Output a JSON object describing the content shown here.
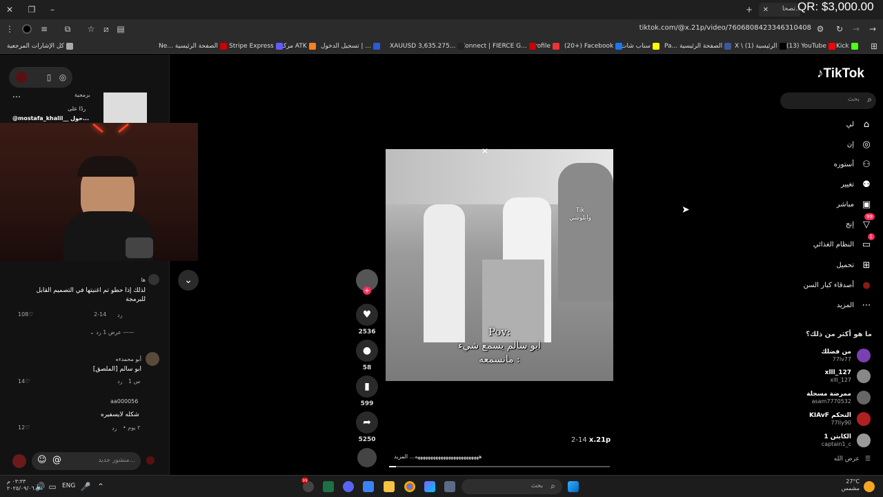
{
  "window": {
    "overlay_title": "QR: $3,000.00",
    "tab_title": "تصحا..."
  },
  "address": {
    "url": "tiktok.com/@x.21p/video/7606808423346310408"
  },
  "bookmarks": [
    {
      "label": "Kick",
      "color": "#53fc18"
    },
    {
      "label": "(13) YouTube",
      "color": "#ff0000"
    },
    {
      "label": "X \\ (1) الرئيسية",
      "color": "#000000"
    },
    {
      "label": "Pa... الصفحة الرئيسية",
      "color": "#3b5998"
    },
    {
      "label": "سناب شات",
      "color": "#fffc00"
    },
    {
      "label": "(20+) Facebook",
      "color": "#1877f2"
    },
    {
      "label": "Profile",
      "color": "#e33"
    },
    {
      "label": "Connect | FIERCE G...",
      "color": "#c00"
    },
    {
      "label": "XAUUSD 3,635.275...",
      "color": "#222"
    },
    {
      "label": "تسجيل الدخول | ...",
      "color": "#2a5bd7"
    },
    {
      "label": "مركز ATK",
      "color": "#f58220"
    },
    {
      "label": "Stripe Express",
      "color": "#635bff"
    },
    {
      "label": "Ne... الصفحة الرئيسية",
      "color": "#c00"
    },
    {
      "label": "كل الإشارات المرجعية",
      "color": "#aaa"
    }
  ],
  "tiktok": {
    "logo": "TikTok",
    "search_placeholder": "بحث",
    "nav": [
      {
        "label": "لي",
        "icon": "home-icon",
        "glyph": "⌂"
      },
      {
        "label": "إن",
        "icon": "compass-icon",
        "glyph": "◎"
      },
      {
        "label": "أستوره",
        "icon": "user-plus-icon",
        "glyph": "⚇"
      },
      {
        "label": "تغيير",
        "icon": "users-icon",
        "glyph": "⚉"
      },
      {
        "label": "مباشر",
        "icon": "live-icon",
        "glyph": "▣"
      },
      {
        "label": "إنج",
        "icon": "inbox-icon",
        "glyph": "▽",
        "badge": "99"
      },
      {
        "label": "النظام الغذائي",
        "icon": "message-icon",
        "glyph": "▭",
        "badge": "1"
      },
      {
        "label": "تحميل",
        "icon": "upload-icon",
        "glyph": "⊞"
      },
      {
        "label": "أصدقاء كبار السن",
        "icon": "avatar-icon",
        "glyph": "●"
      },
      {
        "label": "المزيد",
        "icon": "more-icon",
        "glyph": "⋯"
      }
    ],
    "suggested_title": "ما هو أكثر من ذلك؟",
    "accounts": [
      {
        "name": "من فضلك",
        "handle": "77lv77",
        "color": "#7a3fb0"
      },
      {
        "name": "xlll_127",
        "handle": "xlll_127",
        "color": "#888"
      },
      {
        "name": "ممرضة مسجلة",
        "handle": "asam7770532",
        "color": "#666"
      },
      {
        "name": "التحكم KIAvF",
        "handle": "77lly90",
        "color": "#b02020"
      },
      {
        "name": "الكابتن 1",
        "handle": "captain1_c",
        "color": "#999"
      }
    ],
    "see_more": "عرض الله",
    "video_overlay": {
      "top_label": "Tik\nوانلوشي",
      "caption_title": "Pov:",
      "caption_line1": "ابو سالم يسمع شيء",
      "caption_line2": "مانسمعه :"
    },
    "video_author": "x.21p",
    "video_date": "2-14",
    "video_desc": "هههههههههههههههههههههههههه... المزيد",
    "actions": {
      "likes": "2536",
      "comments": "58",
      "saves": "599",
      "shares": "5250"
    }
  },
  "comments_panel": {
    "top_tag": "برمجية",
    "reply_prefix": "ردًا على",
    "reply_to": "@mostafa_khalil__ حول...",
    "comments": [
      {
        "user": "ها",
        "text": "لذلك إذا حطو تم اغنيتها في التصميم القابل للبرمجة",
        "date": "2-14",
        "reply": "رد",
        "likes": "108",
        "view_replies": "عرض 1 رد"
      },
      {
        "user": "أبو محمدءه",
        "text": "ابو سالم [الملصق]",
        "date": "س 1",
        "reply": "رد",
        "likes": "14"
      },
      {
        "user": "aa000056",
        "text": "شكله لايسفيره",
        "date": "• ٢ يوم",
        "reply": "رد",
        "likes": "12"
      }
    ],
    "input_placeholder": "منشور جديد..."
  },
  "taskbar": {
    "search_placeholder": "بحث",
    "time": "٠٣:٣٣ م",
    "date": "٢٠٢٥/٠٩/٠٦",
    "lang": "ENG",
    "weather_temp": "27°C",
    "weather_desc": "مشمس",
    "notification_badge": "99"
  }
}
